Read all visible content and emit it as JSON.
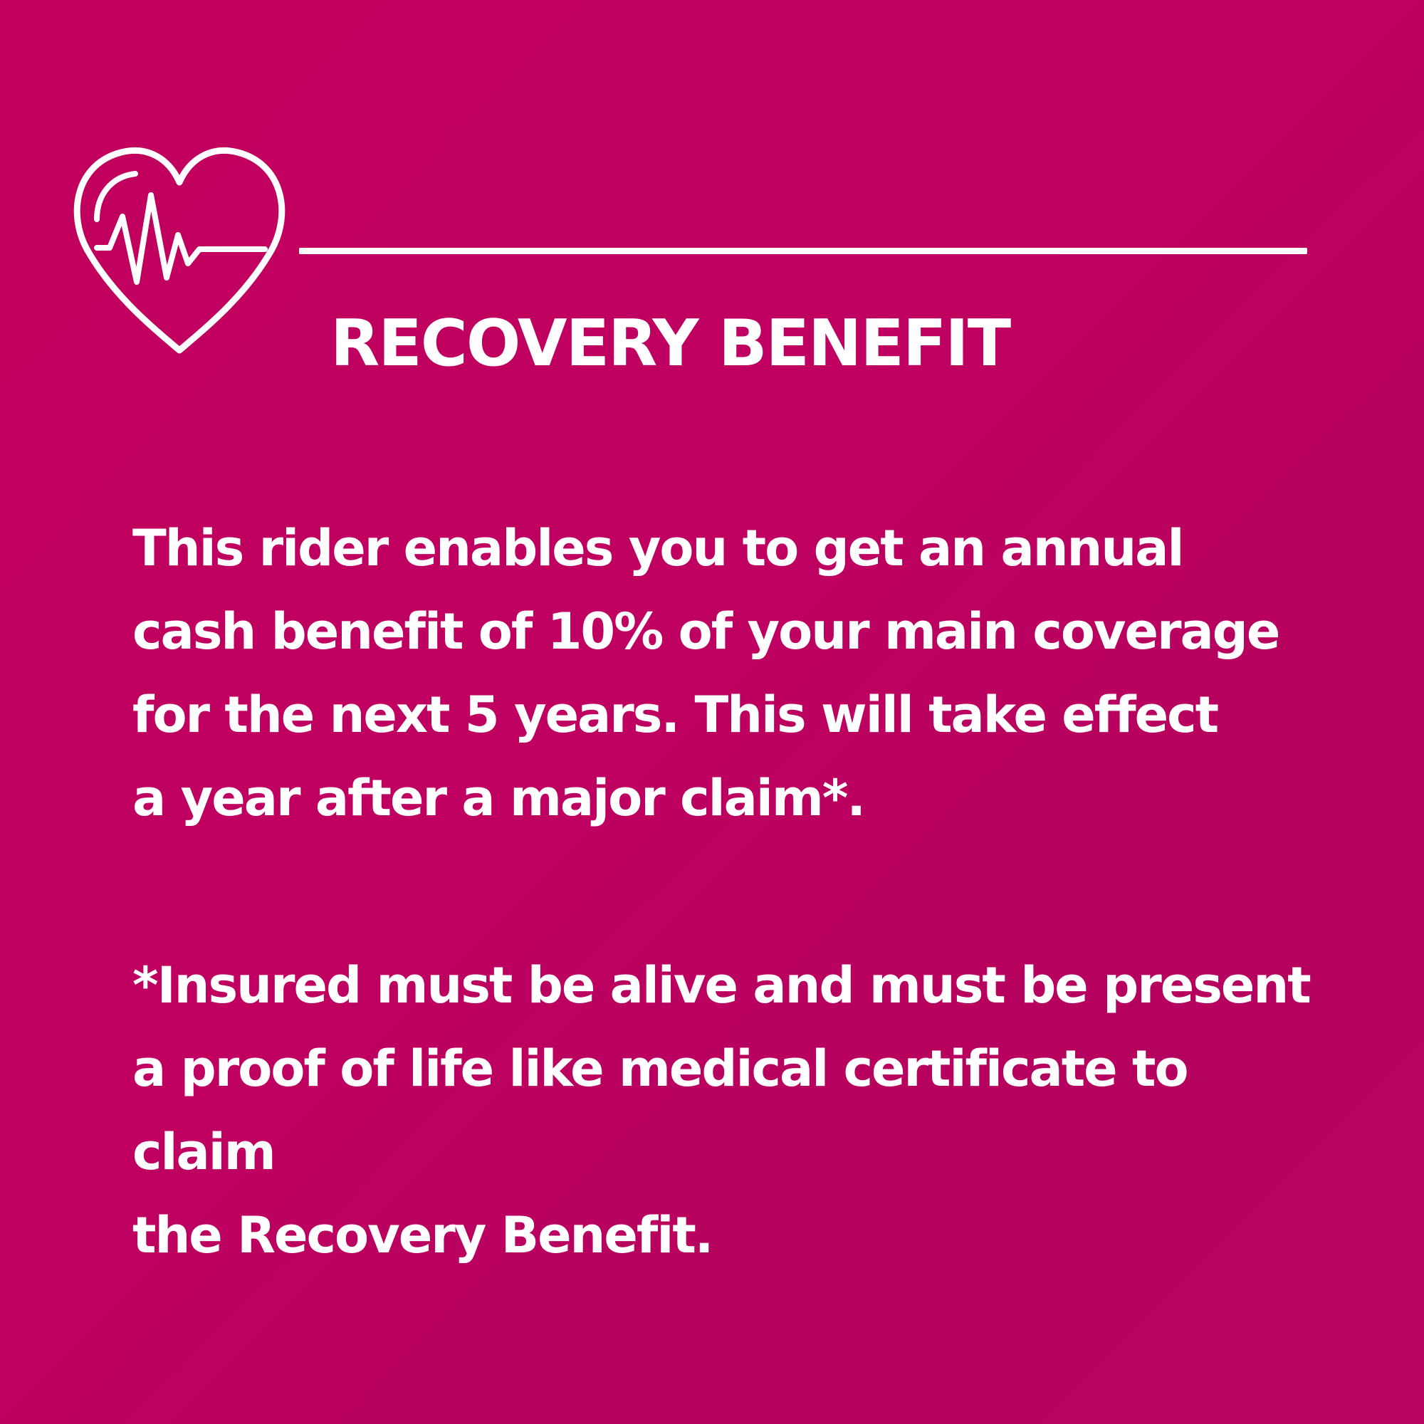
{
  "card": {
    "icon": "heart-pulse-icon",
    "title": "RECOVERY BENEFIT",
    "description": "This rider enables you to get an annual\ncash benefit of 10% of your main coverage\nfor the next 5 years. This will take effect\na year after a major claim*.",
    "footnote": "*Insured must be alive and must be present\na proof of life like medical certificate to claim\nthe Recovery Benefit."
  },
  "colors": {
    "background": "#c0005f",
    "foreground": "#ffffff"
  }
}
